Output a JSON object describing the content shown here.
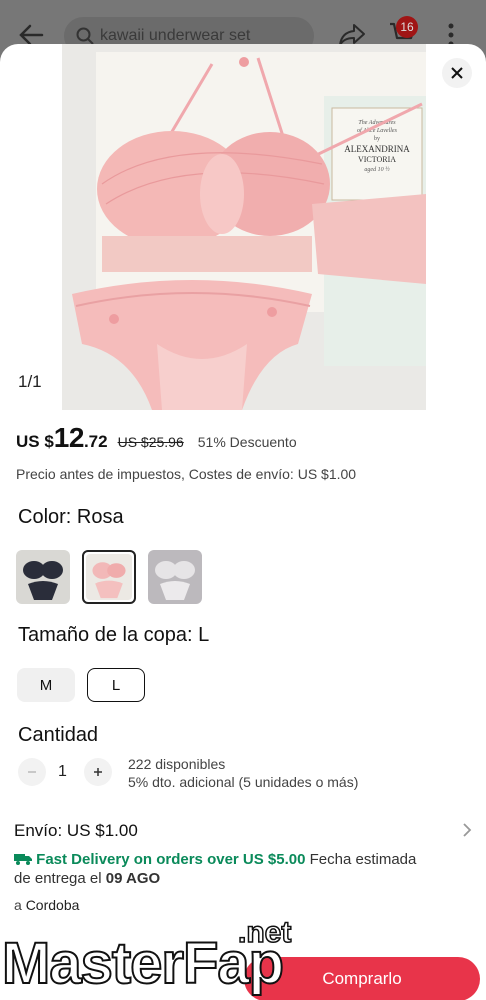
{
  "background_header": {
    "search_placeholder": "kawaii underwear set",
    "cart_count": "16",
    "icons": [
      "back-arrow-icon",
      "search-icon",
      "share-icon",
      "cart-icon",
      "more-vert-icon"
    ]
  },
  "gallery": {
    "counter": "1/1",
    "book_title_lines": [
      "The Adventures",
      "of Alice Lavelles",
      "by",
      "ALEXANDRINA",
      "VICTORIA",
      "aged 10 ½"
    ]
  },
  "price": {
    "currency": "US $",
    "integer": "12",
    "decimal": ".72",
    "original": "US $25.96",
    "discount": "51% Descuento",
    "note": "Precio antes de impuestos, Costes de envío: US $1.00"
  },
  "color": {
    "title": "Color:  Rosa",
    "options": [
      {
        "name": "black",
        "color": "#2a2d3a"
      },
      {
        "name": "pink",
        "color": "#f2b8b8"
      },
      {
        "name": "white",
        "color": "#e6e4e6"
      }
    ],
    "selected_index": 1
  },
  "cup_size": {
    "title": "Tamaño de la copa:  L",
    "options": [
      "M",
      "L"
    ],
    "selected": "L"
  },
  "quantity": {
    "title": "Cantidad",
    "value": "1",
    "available": "222 disponibles",
    "bulk_discount": "5% dto. adicional (5 unidades o más)"
  },
  "shipping": {
    "title": "Envío: US $1.00",
    "fast_delivery": "Fast Delivery on orders over US $5.00",
    "eta_prefix": " Fecha estimada de entrega el ",
    "eta_date": "09 AGO",
    "to_prefix": "a ",
    "to_city": "Cordoba"
  },
  "actions": {
    "buy_label": "Comprarlo"
  },
  "watermark": {
    "main": "MasterFap",
    "suffix": ".net"
  },
  "colors": {
    "accent_red": "#e8344a",
    "fast_green": "#0a8a5a",
    "badge_red": "#a01515"
  }
}
